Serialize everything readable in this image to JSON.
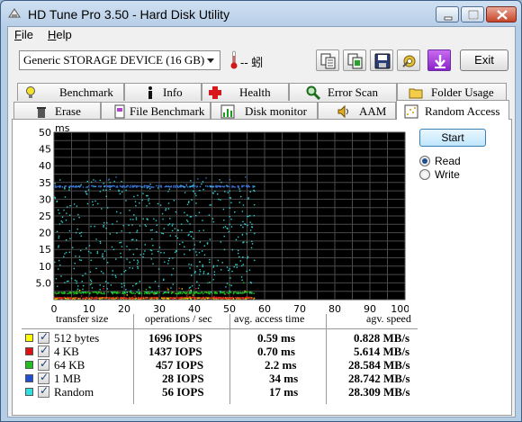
{
  "window": {
    "title": "HD Tune Pro 3.50 - Hard Disk Utility"
  },
  "menu": {
    "items": [
      {
        "label": "File",
        "mnemonic": "F",
        "rest": "ile"
      },
      {
        "label": "Help",
        "mnemonic": "H",
        "rest": "elp"
      }
    ]
  },
  "toolbar": {
    "device": "Generic STORAGE DEVICE (16 GB)",
    "temperature": "-- 蚓",
    "buttons": [
      "copy-info-icon",
      "copy-text-icon",
      "save-icon",
      "options-icon",
      "download-icon"
    ],
    "exit_label": "Exit"
  },
  "tabs": {
    "row1": [
      {
        "label": "Benchmark",
        "icon": "bulb-icon"
      },
      {
        "label": "Info",
        "icon": "info-icon"
      },
      {
        "label": "Health",
        "icon": "health-cross-icon"
      },
      {
        "label": "Error Scan",
        "icon": "magnifier-icon"
      },
      {
        "label": "Folder Usage",
        "icon": "folder-icon"
      }
    ],
    "row2": [
      {
        "label": "Erase",
        "icon": "trash-icon"
      },
      {
        "label": "File Benchmark",
        "icon": "file-icon"
      },
      {
        "label": "Disk monitor",
        "icon": "bar-chart-icon"
      },
      {
        "label": "AAM",
        "icon": "speaker-icon"
      },
      {
        "label": "Random Access",
        "icon": "random-access-icon",
        "active": true
      }
    ]
  },
  "controls": {
    "start_label": "Start",
    "read_label": "Read",
    "write_label": "Write",
    "selected": "Read"
  },
  "chart_data": {
    "type": "scatter",
    "ylabel": "ms",
    "ylim": [
      0,
      50
    ],
    "y_ticks": [
      "50",
      "45",
      "40",
      "35",
      "30",
      "25",
      "20",
      "15",
      "10",
      "5.0"
    ],
    "xlim": [
      0,
      100
    ],
    "x_ticks": [
      "0",
      "10",
      "20",
      "30",
      "40",
      "50",
      "60",
      "70",
      "80",
      "90",
      "100%"
    ],
    "grid": true,
    "background": "#000000",
    "progress_percent": 57,
    "series": [
      {
        "name": "512 bytes",
        "color": "#e6e600",
        "typical_ms": 0.59
      },
      {
        "name": "4 KB",
        "color": "#e02020",
        "typical_ms": 0.7
      },
      {
        "name": "64 KB",
        "color": "#20c020",
        "typical_ms": 2.2
      },
      {
        "name": "1 MB",
        "color": "#3a70d0",
        "typical_ms": 34
      },
      {
        "name": "Random",
        "color": "#30d0d0",
        "typical_ms": 17
      }
    ]
  },
  "results": {
    "headers": {
      "size": "transfer size",
      "ops": "operations / sec",
      "access": "avg. access time",
      "speed": "agv. speed"
    },
    "rows": [
      {
        "size": "512 bytes",
        "color": "#ffff00",
        "ops": "1696 IOPS",
        "access": "0.59 ms",
        "speed": "0.828 MB/s"
      },
      {
        "size": "4 KB",
        "color": "#e01010",
        "ops": "1437 IOPS",
        "access": "0.70 ms",
        "speed": "5.614 MB/s"
      },
      {
        "size": "64 KB",
        "color": "#20c020",
        "ops": "457 IOPS",
        "access": "2.2 ms",
        "speed": "28.584 MB/s"
      },
      {
        "size": "1 MB",
        "color": "#2050d0",
        "ops": "28 IOPS",
        "access": "34 ms",
        "speed": "28.742 MB/s"
      },
      {
        "size": "Random",
        "color": "#30e0e0",
        "ops": "56 IOPS",
        "access": "17 ms",
        "speed": "28.309 MB/s"
      }
    ]
  }
}
